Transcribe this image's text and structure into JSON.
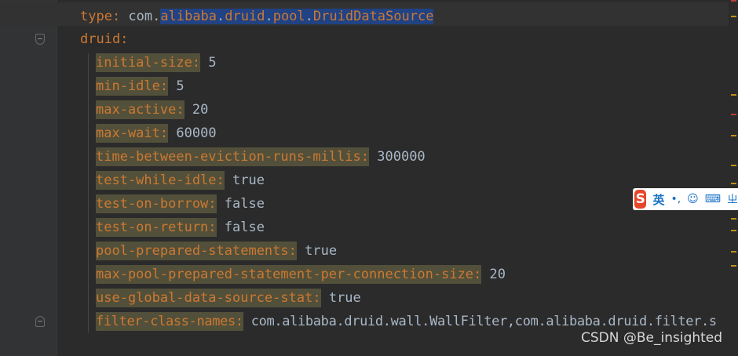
{
  "editor": {
    "line_type": {
      "key": "type:",
      "value_prefix": " com.",
      "sel_parts": [
        "alibaba",
        ".",
        "druid",
        ".",
        "pool",
        ".",
        "DruidDataSource"
      ]
    },
    "line_druid": {
      "key": "druid:"
    },
    "properties": [
      {
        "key": "initial-size:",
        "value": "5"
      },
      {
        "key": "min-idle:",
        "value": "5"
      },
      {
        "key": "max-active:",
        "value": "20"
      },
      {
        "key": "max-wait:",
        "value": "60000"
      },
      {
        "key": "time-between-eviction-runs-millis:",
        "value": "300000"
      },
      {
        "key": "test-while-idle:",
        "value": "true"
      },
      {
        "key": "test-on-borrow:",
        "value": "false"
      },
      {
        "key": "test-on-return:",
        "value": "false"
      },
      {
        "key": "pool-prepared-statements:",
        "value": "true"
      },
      {
        "key": "max-pool-prepared-statement-per-connection-size:",
        "value": "20"
      },
      {
        "key": "use-global-data-source-stat:",
        "value": "true"
      },
      {
        "key": "filter-class-names:",
        "value": "com.alibaba.druid.wall.WallFilter,com.alibaba.druid.filter.s"
      }
    ]
  },
  "ime": {
    "logo": "S",
    "mode": "英",
    "punct": "•,",
    "smile_icon": "☺",
    "keyboard_icon": "⌨",
    "extra": "ㄓ"
  },
  "watermark": "CSDN @Be_insighted",
  "colors": {
    "background": "#2b2b2b",
    "key": "#cc7832",
    "value": "#a9b7c6",
    "selection": "#214283",
    "key_highlight": "#52503a"
  }
}
